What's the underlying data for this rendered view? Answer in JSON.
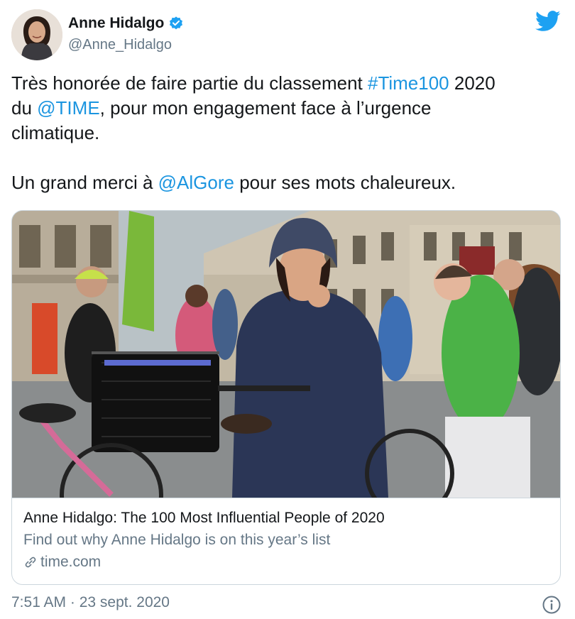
{
  "author": {
    "name": "Anne Hidalgo",
    "handle": "@Anne_Hidalgo",
    "verified": true
  },
  "icons": {
    "brand": "twitter-bird-icon",
    "verified": "verified-badge-icon",
    "link": "link-icon",
    "info": "info-icon"
  },
  "tweet": {
    "line1_pre": "Très honorée de faire partie du classement ",
    "line1_hashtag": "#Time100",
    "line1_post": " 2020",
    "line2_pre": "du ",
    "line2_mention": "@TIME",
    "line2_post": ", pour mon engagement face à l’urgence",
    "line3": "climatique.",
    "para2_pre": "Un grand merci à ",
    "para2_mention": "@AlGore",
    "para2_post": " pour ses mots chaleureux."
  },
  "card": {
    "title": "Anne Hidalgo: The 100 Most Influential People of 2020",
    "description": "Find out why Anne Hidalgo is on this year’s list",
    "domain": "time.com"
  },
  "meta": {
    "timestamp": "7:51 AM · 23 sept. 2020"
  },
  "colors": {
    "link": "#1b95e0",
    "text": "#14171a",
    "secondary": "#657786",
    "border": "#ccd6dd"
  }
}
